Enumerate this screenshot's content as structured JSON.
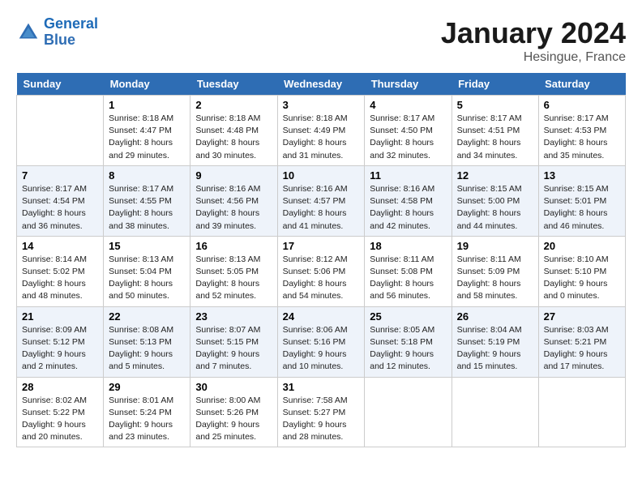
{
  "header": {
    "logo_line1": "General",
    "logo_line2": "Blue",
    "month": "January 2024",
    "location": "Hesingue, France"
  },
  "weekdays": [
    "Sunday",
    "Monday",
    "Tuesday",
    "Wednesday",
    "Thursday",
    "Friday",
    "Saturday"
  ],
  "weeks": [
    [
      {
        "day": "",
        "sunrise": "",
        "sunset": "",
        "daylight": ""
      },
      {
        "day": "1",
        "sunrise": "Sunrise: 8:18 AM",
        "sunset": "Sunset: 4:47 PM",
        "daylight": "Daylight: 8 hours and 29 minutes."
      },
      {
        "day": "2",
        "sunrise": "Sunrise: 8:18 AM",
        "sunset": "Sunset: 4:48 PM",
        "daylight": "Daylight: 8 hours and 30 minutes."
      },
      {
        "day": "3",
        "sunrise": "Sunrise: 8:18 AM",
        "sunset": "Sunset: 4:49 PM",
        "daylight": "Daylight: 8 hours and 31 minutes."
      },
      {
        "day": "4",
        "sunrise": "Sunrise: 8:17 AM",
        "sunset": "Sunset: 4:50 PM",
        "daylight": "Daylight: 8 hours and 32 minutes."
      },
      {
        "day": "5",
        "sunrise": "Sunrise: 8:17 AM",
        "sunset": "Sunset: 4:51 PM",
        "daylight": "Daylight: 8 hours and 34 minutes."
      },
      {
        "day": "6",
        "sunrise": "Sunrise: 8:17 AM",
        "sunset": "Sunset: 4:53 PM",
        "daylight": "Daylight: 8 hours and 35 minutes."
      }
    ],
    [
      {
        "day": "7",
        "sunrise": "Sunrise: 8:17 AM",
        "sunset": "Sunset: 4:54 PM",
        "daylight": "Daylight: 8 hours and 36 minutes."
      },
      {
        "day": "8",
        "sunrise": "Sunrise: 8:17 AM",
        "sunset": "Sunset: 4:55 PM",
        "daylight": "Daylight: 8 hours and 38 minutes."
      },
      {
        "day": "9",
        "sunrise": "Sunrise: 8:16 AM",
        "sunset": "Sunset: 4:56 PM",
        "daylight": "Daylight: 8 hours and 39 minutes."
      },
      {
        "day": "10",
        "sunrise": "Sunrise: 8:16 AM",
        "sunset": "Sunset: 4:57 PM",
        "daylight": "Daylight: 8 hours and 41 minutes."
      },
      {
        "day": "11",
        "sunrise": "Sunrise: 8:16 AM",
        "sunset": "Sunset: 4:58 PM",
        "daylight": "Daylight: 8 hours and 42 minutes."
      },
      {
        "day": "12",
        "sunrise": "Sunrise: 8:15 AM",
        "sunset": "Sunset: 5:00 PM",
        "daylight": "Daylight: 8 hours and 44 minutes."
      },
      {
        "day": "13",
        "sunrise": "Sunrise: 8:15 AM",
        "sunset": "Sunset: 5:01 PM",
        "daylight": "Daylight: 8 hours and 46 minutes."
      }
    ],
    [
      {
        "day": "14",
        "sunrise": "Sunrise: 8:14 AM",
        "sunset": "Sunset: 5:02 PM",
        "daylight": "Daylight: 8 hours and 48 minutes."
      },
      {
        "day": "15",
        "sunrise": "Sunrise: 8:13 AM",
        "sunset": "Sunset: 5:04 PM",
        "daylight": "Daylight: 8 hours and 50 minutes."
      },
      {
        "day": "16",
        "sunrise": "Sunrise: 8:13 AM",
        "sunset": "Sunset: 5:05 PM",
        "daylight": "Daylight: 8 hours and 52 minutes."
      },
      {
        "day": "17",
        "sunrise": "Sunrise: 8:12 AM",
        "sunset": "Sunset: 5:06 PM",
        "daylight": "Daylight: 8 hours and 54 minutes."
      },
      {
        "day": "18",
        "sunrise": "Sunrise: 8:11 AM",
        "sunset": "Sunset: 5:08 PM",
        "daylight": "Daylight: 8 hours and 56 minutes."
      },
      {
        "day": "19",
        "sunrise": "Sunrise: 8:11 AM",
        "sunset": "Sunset: 5:09 PM",
        "daylight": "Daylight: 8 hours and 58 minutes."
      },
      {
        "day": "20",
        "sunrise": "Sunrise: 8:10 AM",
        "sunset": "Sunset: 5:10 PM",
        "daylight": "Daylight: 9 hours and 0 minutes."
      }
    ],
    [
      {
        "day": "21",
        "sunrise": "Sunrise: 8:09 AM",
        "sunset": "Sunset: 5:12 PM",
        "daylight": "Daylight: 9 hours and 2 minutes."
      },
      {
        "day": "22",
        "sunrise": "Sunrise: 8:08 AM",
        "sunset": "Sunset: 5:13 PM",
        "daylight": "Daylight: 9 hours and 5 minutes."
      },
      {
        "day": "23",
        "sunrise": "Sunrise: 8:07 AM",
        "sunset": "Sunset: 5:15 PM",
        "daylight": "Daylight: 9 hours and 7 minutes."
      },
      {
        "day": "24",
        "sunrise": "Sunrise: 8:06 AM",
        "sunset": "Sunset: 5:16 PM",
        "daylight": "Daylight: 9 hours and 10 minutes."
      },
      {
        "day": "25",
        "sunrise": "Sunrise: 8:05 AM",
        "sunset": "Sunset: 5:18 PM",
        "daylight": "Daylight: 9 hours and 12 minutes."
      },
      {
        "day": "26",
        "sunrise": "Sunrise: 8:04 AM",
        "sunset": "Sunset: 5:19 PM",
        "daylight": "Daylight: 9 hours and 15 minutes."
      },
      {
        "day": "27",
        "sunrise": "Sunrise: 8:03 AM",
        "sunset": "Sunset: 5:21 PM",
        "daylight": "Daylight: 9 hours and 17 minutes."
      }
    ],
    [
      {
        "day": "28",
        "sunrise": "Sunrise: 8:02 AM",
        "sunset": "Sunset: 5:22 PM",
        "daylight": "Daylight: 9 hours and 20 minutes."
      },
      {
        "day": "29",
        "sunrise": "Sunrise: 8:01 AM",
        "sunset": "Sunset: 5:24 PM",
        "daylight": "Daylight: 9 hours and 23 minutes."
      },
      {
        "day": "30",
        "sunrise": "Sunrise: 8:00 AM",
        "sunset": "Sunset: 5:26 PM",
        "daylight": "Daylight: 9 hours and 25 minutes."
      },
      {
        "day": "31",
        "sunrise": "Sunrise: 7:58 AM",
        "sunset": "Sunset: 5:27 PM",
        "daylight": "Daylight: 9 hours and 28 minutes."
      },
      {
        "day": "",
        "sunrise": "",
        "sunset": "",
        "daylight": ""
      },
      {
        "day": "",
        "sunrise": "",
        "sunset": "",
        "daylight": ""
      },
      {
        "day": "",
        "sunrise": "",
        "sunset": "",
        "daylight": ""
      }
    ]
  ]
}
